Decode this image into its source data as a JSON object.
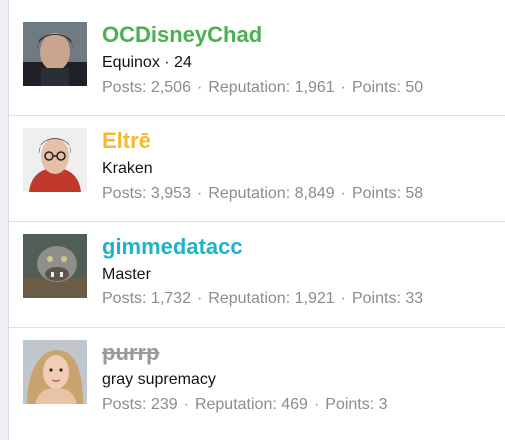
{
  "stat_labels": {
    "posts": "Posts:",
    "reputation": "Reputation:",
    "points": "Points:",
    "separator": "·"
  },
  "members": [
    {
      "name": "OCDisneyChad",
      "name_color": "#4caf50",
      "title": "Equinox · 24",
      "posts": "2,506",
      "reputation": "1,961",
      "points": "50",
      "avatar_icon": "user-avatar-icon"
    },
    {
      "name": "Eltrē",
      "name_color": "#f5b82e",
      "title": "Kraken",
      "posts": "3,953",
      "reputation": "8,849",
      "points": "58",
      "avatar_icon": "user-avatar-icon"
    },
    {
      "name": "gimmedatacc",
      "name_color": "#1eb3c8",
      "title": "Master",
      "posts": "1,732",
      "reputation": "1,921",
      "points": "33",
      "avatar_icon": "user-avatar-icon"
    },
    {
      "name": "purrp",
      "name_color": "#9a9a9a",
      "name_strikethrough": true,
      "title": "gray supremacy",
      "posts": "239",
      "reputation": "469",
      "points": "3",
      "avatar_icon": "user-avatar-icon"
    }
  ]
}
